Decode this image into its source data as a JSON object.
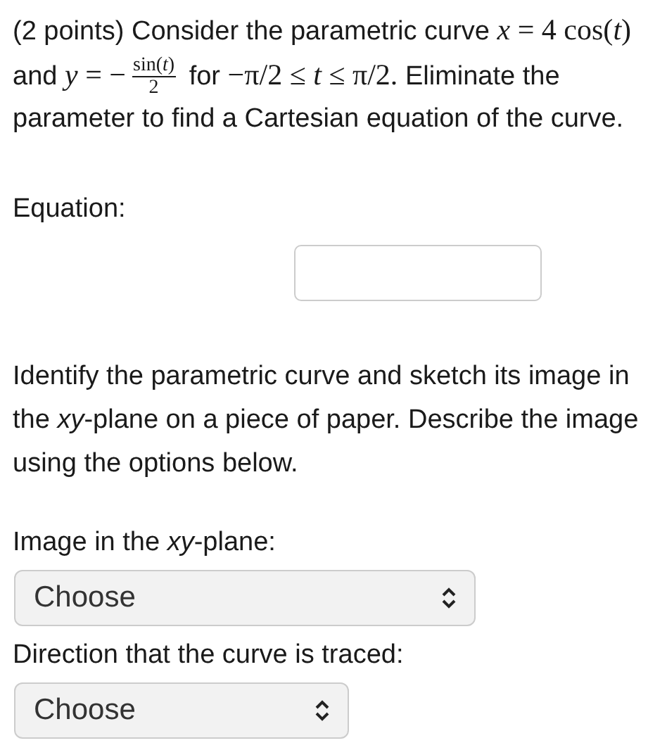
{
  "question": {
    "segments": [
      {
        "kind": "text",
        "text": "(2 points) Consider the parametric curve "
      },
      {
        "kind": "math",
        "text": "*x* = 4 cos(*t*)"
      },
      {
        "kind": "text",
        "text": " and "
      },
      {
        "kind": "math",
        "text": "*y* = −"
      },
      {
        "kind": "frac",
        "num": "sin(*t*)",
        "den": "2"
      },
      {
        "kind": "text",
        "text": " for "
      },
      {
        "kind": "math",
        "text": "−π/2 ≤ *t* ≤ π/2."
      },
      {
        "kind": "text",
        "text": " Eliminate the parameter to find a Cartesian equation of the curve."
      }
    ]
  },
  "equation": {
    "label": "Equation:"
  },
  "instructions": "Identify the parametric curve and sketch its image in the *xy*-plane on a piece of paper. Describe the image using the options below.",
  "selects": [
    {
      "label": "Image in the *xy*-plane:",
      "value": "Choose"
    },
    {
      "label": "Direction that the curve is traced:",
      "value": "Choose"
    }
  ]
}
